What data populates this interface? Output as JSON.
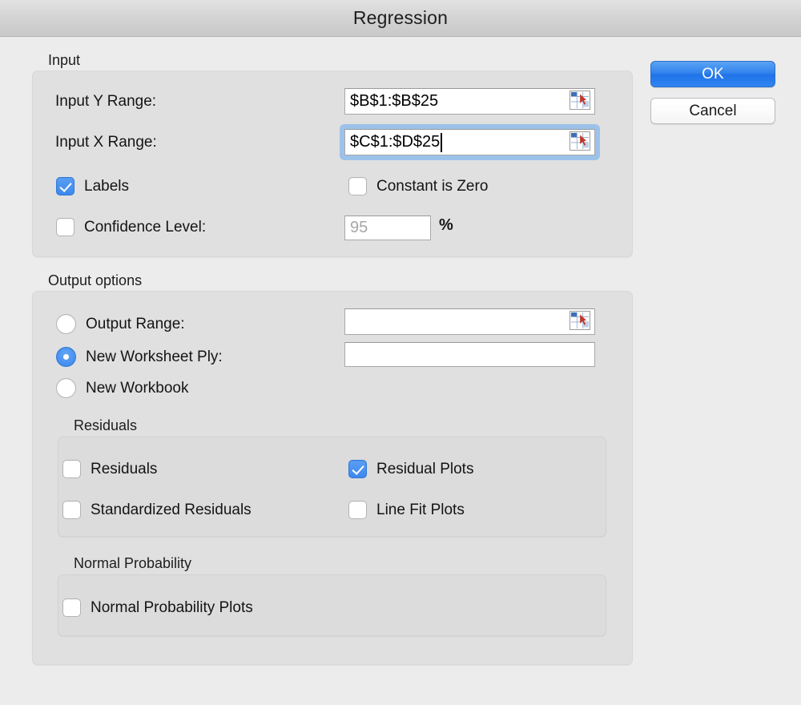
{
  "window": {
    "title": "Regression"
  },
  "buttons": {
    "ok": "OK",
    "cancel": "Cancel"
  },
  "input_section": {
    "legend": "Input",
    "y_range": {
      "label": "Input Y Range:",
      "value": "$B$1:$B$25",
      "picker_icon": "range-select-icon"
    },
    "x_range": {
      "label": "Input X Range:",
      "value": "$C$1:$D$25",
      "picker_icon": "range-select-icon",
      "focused": true
    },
    "labels_checkbox": {
      "label": "Labels",
      "checked": true
    },
    "constant_zero_checkbox": {
      "label": "Constant is Zero",
      "checked": false
    },
    "confidence_level_checkbox": {
      "label": "Confidence Level:",
      "checked": false
    },
    "confidence_level_value": {
      "value": "",
      "placeholder": "95"
    },
    "percent_sign": "%"
  },
  "output_section": {
    "legend": "Output options",
    "output_range": {
      "label": "Output Range:",
      "selected": false,
      "value": "",
      "picker_icon": "range-select-icon"
    },
    "new_worksheet_ply": {
      "label": "New Worksheet Ply:",
      "selected": true,
      "value": ""
    },
    "new_workbook": {
      "label": "New Workbook",
      "selected": false
    },
    "residuals_group": {
      "legend": "Residuals",
      "items": [
        {
          "label": "Residuals",
          "checked": false
        },
        {
          "label": "Residual Plots",
          "checked": true
        },
        {
          "label": "Standardized Residuals",
          "checked": false
        },
        {
          "label": "Line Fit Plots",
          "checked": false
        }
      ]
    },
    "normal_probability_group": {
      "legend": "Normal Probability",
      "items": [
        {
          "label": "Normal Probability Plots",
          "checked": false
        }
      ]
    }
  },
  "colors": {
    "accent": "#3a86ec",
    "ok_button": "#2f80ec",
    "focus_ring": "#9cc2ea",
    "dialog_bg": "#ececec",
    "group_bg": "#e0e0e0"
  }
}
